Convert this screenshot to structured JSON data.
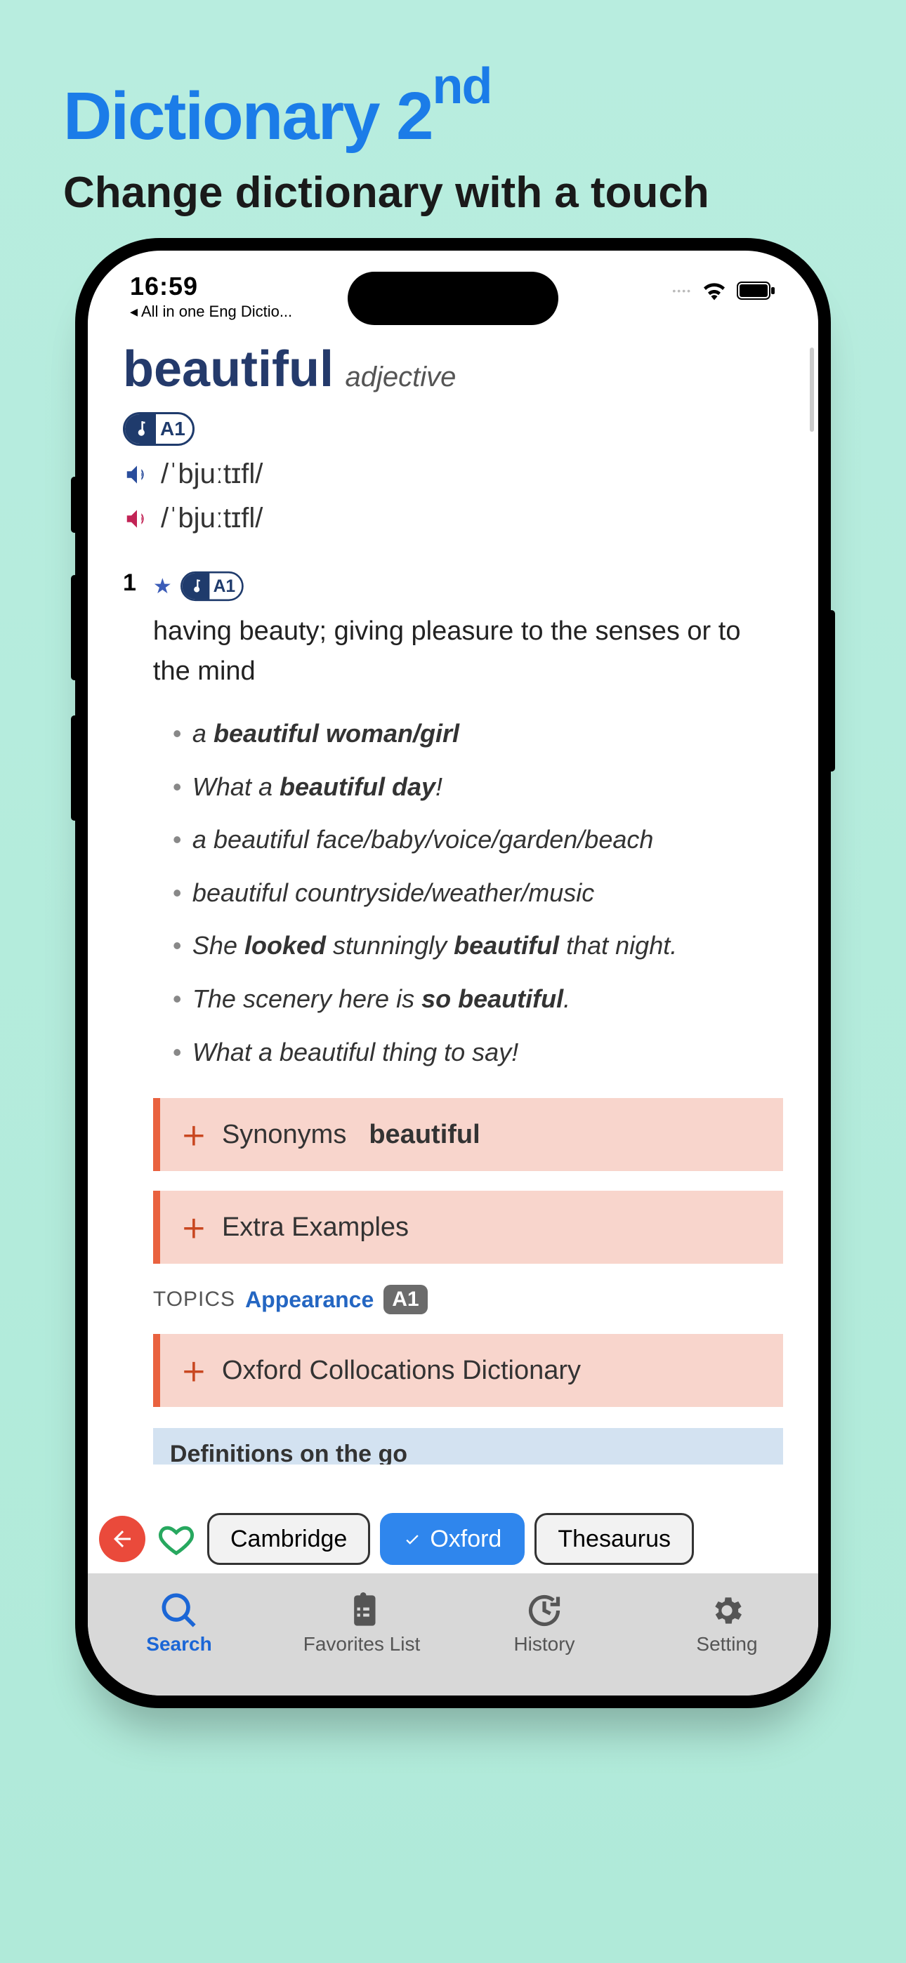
{
  "promo": {
    "title_main": "Dictionary 2",
    "title_sup": "nd",
    "subtitle": "Change dictionary with a touch"
  },
  "statusbar": {
    "time": "16:59",
    "back_app": "◂ All in one Eng Dictio..."
  },
  "entry": {
    "headword": "beautiful",
    "pos": "adjective",
    "level": "A1",
    "ipa_uk": "/ˈbjuːtɪfl/",
    "ipa_us": "/ˈbjuːtɪfl/",
    "sense_num": "1",
    "definition": "having beauty; giving pleasure to the senses or to the mind",
    "examples": [
      {
        "pre": "a ",
        "strong": "beautiful woman/girl",
        "post": ""
      },
      {
        "pre": "What a ",
        "strong": "beautiful day",
        "post": "!"
      },
      {
        "pre": "",
        "strong": "",
        "post": "a beautiful face/baby/voice/garden/beach"
      },
      {
        "pre": "",
        "strong": "",
        "post": "beautiful countryside/weather/music"
      },
      {
        "pre": "She ",
        "strong": "looked",
        "mid": " stunningly ",
        "strong2": "beautiful",
        "post": " that night."
      },
      {
        "pre": "The scenery here is ",
        "strong": "so beautiful",
        "post": "."
      },
      {
        "pre": "",
        "strong": "",
        "post": "What a beautiful thing to say!"
      }
    ],
    "expanders": {
      "synonyms_label": "Synonyms",
      "synonyms_word": "beautiful",
      "extra_label": "Extra Examples",
      "colloc_label": "Oxford Collocations Dictionary"
    },
    "topics": {
      "label": "TOPICS",
      "link": "Appearance",
      "level": "A1"
    },
    "bottom_strip": "Definitions on the go"
  },
  "dict_switch": {
    "cambridge": "Cambridge",
    "oxford": "Oxford",
    "thesaurus": "Thesaurus"
  },
  "tabs": {
    "search": "Search",
    "favorites": "Favorites List",
    "history": "History",
    "setting": "Setting"
  }
}
